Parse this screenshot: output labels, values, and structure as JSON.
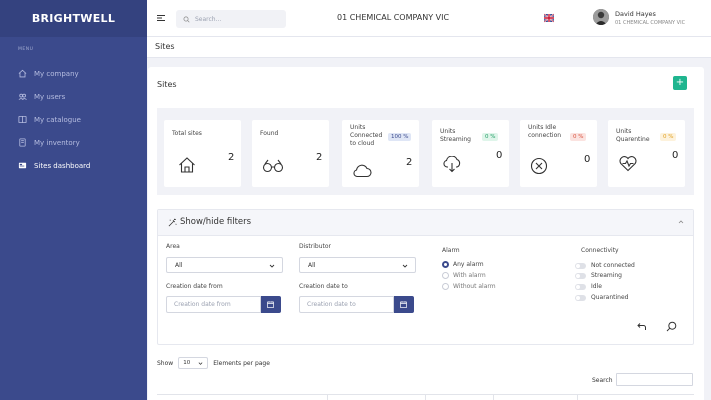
{
  "brand": "BRIGHTWELL",
  "sidebar": {
    "menu_label": "MENU",
    "items": [
      {
        "label": "My company",
        "icon": "home-icon"
      },
      {
        "label": "My users",
        "icon": "users-icon"
      },
      {
        "label": "My catalogue",
        "icon": "catalogue-icon"
      },
      {
        "label": "My inventory",
        "icon": "inventory-icon"
      },
      {
        "label": "Sites dashboard",
        "icon": "dashboard-icon",
        "active": true
      }
    ]
  },
  "topbar": {
    "search_placeholder": "Search...",
    "company": "01 CHEMICAL COMPANY VIC",
    "user_name": "David Hayes",
    "user_company": "01 CHEMICAL COMPANY VIC"
  },
  "page": {
    "header": "Sites",
    "card_title": "Sites",
    "add_label": "+"
  },
  "stats": [
    {
      "label": "Total sites",
      "value": "2",
      "icon": "house-icon"
    },
    {
      "label": "Found",
      "value": "2",
      "icon": "binoculars-icon"
    },
    {
      "label": "Units Connected to cloud",
      "badge": "100 %",
      "value": "2",
      "icon": "cloud-icon"
    },
    {
      "label": "Units Streaming",
      "badge": "0 %",
      "value": "0",
      "icon": "cloud-download-icon"
    },
    {
      "label": "Units Idle connection",
      "badge": "0 %",
      "value": "0",
      "icon": "x-circle-icon"
    },
    {
      "label": "Units Quarentine",
      "badge": "0 %",
      "value": "0",
      "icon": "heart-pulse-icon"
    }
  ],
  "filters": {
    "title": "Show/hide filters",
    "area_label": "Area",
    "area_value": "All",
    "distributor_label": "Distributor",
    "distributor_value": "All",
    "creation_from_label": "Creation date from",
    "creation_from_placeholder": "Creation date from",
    "creation_to_label": "Creation date to",
    "creation_to_placeholder": "Creation date to",
    "alarm_label": "Alarm",
    "alarm_options": [
      "Any alarm",
      "With alarm",
      "Without alarm"
    ],
    "connectivity_label": "Connectivity",
    "connectivity_options": [
      "Not connected",
      "Streaming",
      "Idle",
      "Quarantined"
    ]
  },
  "table": {
    "show_label": "Show",
    "page_size": "10",
    "per_page_label": "Elements per page",
    "search_label": "Search"
  },
  "colors": {
    "sidebar": "#3b4a8c",
    "accent": "#1fb58f",
    "badge_blue_bg": "#dfe6f6",
    "badge_green_bg": "#dff5ea",
    "badge_red_bg": "#fbe3e0",
    "badge_yellow_bg": "#fdf2dc"
  }
}
